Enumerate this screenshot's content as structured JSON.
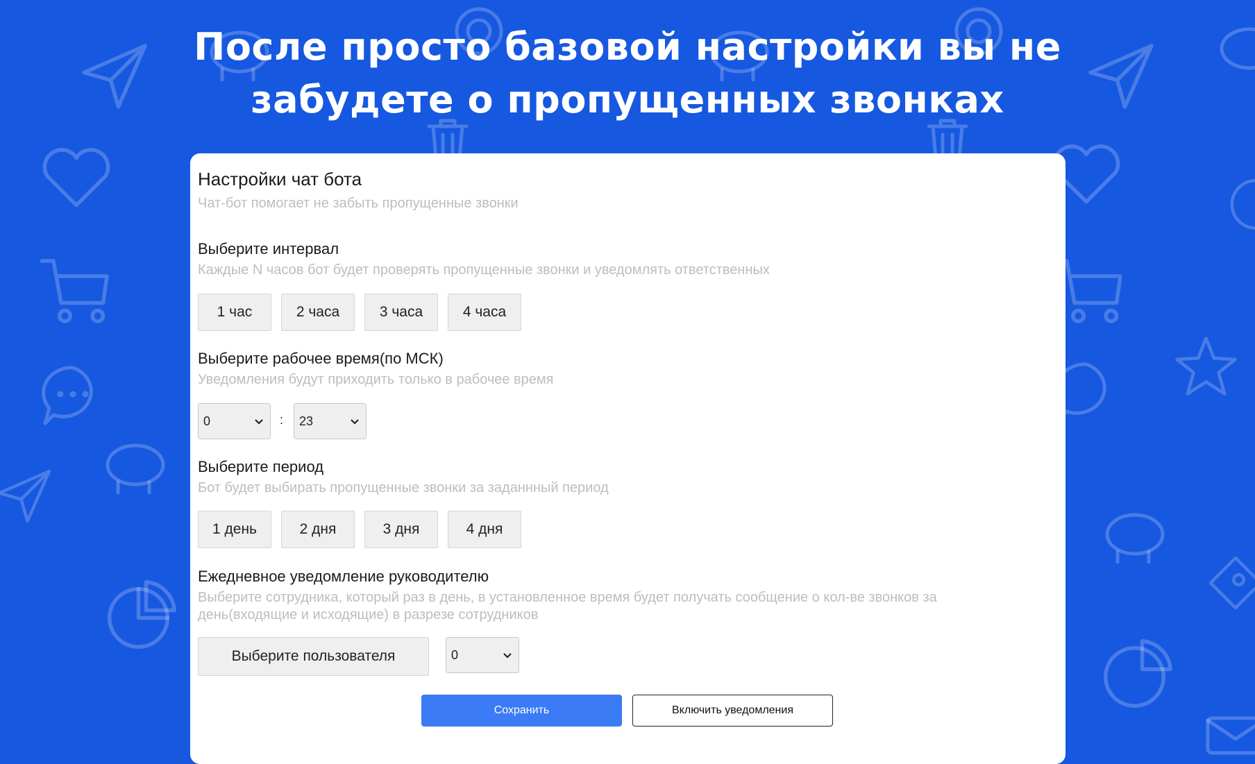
{
  "headline": {
    "line1": "После просто базовой настройки вы не",
    "line2": "забудете о пропущенных звонках"
  },
  "card": {
    "title": "Настройки чат бота",
    "subtitle": "Чат-бот помогает не забыть пропущенные звонки",
    "interval": {
      "heading": "Выберите интервал",
      "hint": "Каждые N часов бот будет проверять пропущенные звонки и уведомлять ответственных",
      "options": [
        "1 час",
        "2 часа",
        "3 часа",
        "4 часа"
      ]
    },
    "work_time": {
      "heading": "Выберите рабочее время(по МСК)",
      "hint": "Уведомления будут приходить только в рабочее время",
      "start_value": "0",
      "separator": ":",
      "end_value": "23"
    },
    "period": {
      "heading": "Выберите период",
      "hint": "Бот будет выбирать пропущенные звонки за заданнный период",
      "options": [
        "1 день",
        "2 дня",
        "3 дня",
        "4 дня"
      ]
    },
    "daily": {
      "heading": "Ежедневное уведомление руководителю",
      "hint_line1": "Выберите сотрудника, который раз в день, в установленное время будет получать сообщение о кол-ве звонков за",
      "hint_line2": "день(входящие и исходящие) в разрезе сотрудников",
      "user_button": "Выберите пользователя",
      "hour_value": "0"
    },
    "save_label": "Сохранить",
    "notify_label": "Включить уведомления"
  },
  "colors": {
    "background": "#1658e0",
    "primary_button": "#3b7bf5",
    "hint_text": "#bdbdbd"
  },
  "background_icons": [
    "paper-plane-icon",
    "gear-icon",
    "piggy-bank-icon",
    "heart-icon",
    "shopping-cart-icon",
    "chat-bubble-icon",
    "star-icon",
    "pie-chart-icon",
    "trash-icon",
    "tag-icon",
    "envelope-icon"
  ]
}
